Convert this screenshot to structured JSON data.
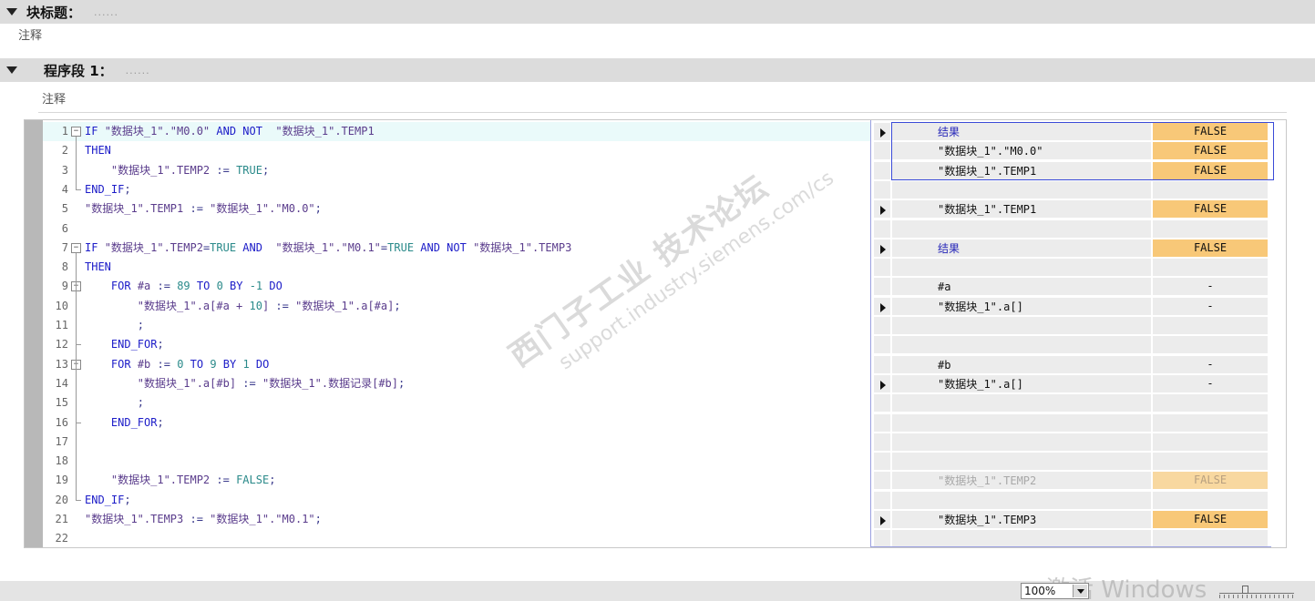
{
  "block": {
    "title": "块标题：",
    "placeholder": "......",
    "comment": "注释"
  },
  "network": {
    "title": "程序段 1：",
    "placeholder": "......",
    "comment": "注释"
  },
  "code": [
    {
      "n": "1",
      "tokens": [
        [
          "kw",
          "IF "
        ],
        [
          "str",
          "\"数据块_1\".\"M0.0\" "
        ],
        [
          "kw",
          "AND NOT  "
        ],
        [
          "str",
          "\"数据块_1\".TEMP1"
        ]
      ]
    },
    {
      "n": "2",
      "tokens": [
        [
          "kw",
          "THEN"
        ]
      ]
    },
    {
      "n": "3",
      "tokens": [
        [
          "t",
          "    "
        ],
        [
          "str",
          "\"数据块_1\".TEMP2 "
        ],
        [
          "t",
          ":= "
        ],
        [
          "num",
          "TRUE"
        ],
        [
          "t",
          ";"
        ]
      ]
    },
    {
      "n": "4",
      "tokens": [
        [
          "kw",
          "END_IF"
        ],
        [
          "t",
          ";"
        ]
      ]
    },
    {
      "n": "5",
      "tokens": [
        [
          "str",
          "\"数据块_1\".TEMP1 "
        ],
        [
          "t",
          ":= "
        ],
        [
          "str",
          "\"数据块_1\".\"M0.0\""
        ],
        [
          "t",
          ";"
        ]
      ]
    },
    {
      "n": "6",
      "tokens": []
    },
    {
      "n": "7",
      "tokens": [
        [
          "kw",
          "IF "
        ],
        [
          "str",
          "\"数据块_1\".TEMP2"
        ],
        [
          "t",
          "="
        ],
        [
          "num",
          "TRUE "
        ],
        [
          "kw",
          "AND  "
        ],
        [
          "str",
          "\"数据块_1\".\"M0.1\""
        ],
        [
          "t",
          "="
        ],
        [
          "num",
          "TRUE "
        ],
        [
          "kw",
          "AND NOT "
        ],
        [
          "str",
          "\"数据块_1\".TEMP3"
        ]
      ]
    },
    {
      "n": "8",
      "tokens": [
        [
          "kw",
          "THEN"
        ]
      ]
    },
    {
      "n": "9",
      "tokens": [
        [
          "t",
          "    "
        ],
        [
          "kw",
          "FOR "
        ],
        [
          "str",
          "#a "
        ],
        [
          "t",
          ":= "
        ],
        [
          "num",
          "89 "
        ],
        [
          "kw",
          "TO "
        ],
        [
          "num",
          "0 "
        ],
        [
          "kw",
          "BY "
        ],
        [
          "num",
          "-1 "
        ],
        [
          "kw",
          "DO"
        ]
      ]
    },
    {
      "n": "10",
      "tokens": [
        [
          "t",
          "        "
        ],
        [
          "str",
          "\"数据块_1\".a[#a + "
        ],
        [
          "num",
          "10"
        ],
        [
          "str",
          "] "
        ],
        [
          "t",
          ":= "
        ],
        [
          "str",
          "\"数据块_1\".a[#a]"
        ],
        [
          "t",
          ";"
        ]
      ]
    },
    {
      "n": "11",
      "tokens": [
        [
          "t",
          "        ;"
        ]
      ]
    },
    {
      "n": "12",
      "tokens": [
        [
          "t",
          "    "
        ],
        [
          "kw",
          "END_FOR"
        ],
        [
          "t",
          ";"
        ]
      ]
    },
    {
      "n": "13",
      "tokens": [
        [
          "t",
          "    "
        ],
        [
          "kw",
          "FOR "
        ],
        [
          "str",
          "#b "
        ],
        [
          "t",
          ":= "
        ],
        [
          "num",
          "0 "
        ],
        [
          "kw",
          "TO "
        ],
        [
          "num",
          "9 "
        ],
        [
          "kw",
          "BY "
        ],
        [
          "num",
          "1 "
        ],
        [
          "kw",
          "DO"
        ]
      ]
    },
    {
      "n": "14",
      "tokens": [
        [
          "t",
          "        "
        ],
        [
          "str",
          "\"数据块_1\".a[#b] "
        ],
        [
          "t",
          ":= "
        ],
        [
          "str",
          "\"数据块_1\".数据记录[#b]"
        ],
        [
          "t",
          ";"
        ]
      ]
    },
    {
      "n": "15",
      "tokens": [
        [
          "t",
          "        ;"
        ]
      ]
    },
    {
      "n": "16",
      "tokens": [
        [
          "t",
          "    "
        ],
        [
          "kw",
          "END_FOR"
        ],
        [
          "t",
          ";"
        ]
      ]
    },
    {
      "n": "17",
      "tokens": []
    },
    {
      "n": "18",
      "tokens": []
    },
    {
      "n": "19",
      "tokens": [
        [
          "t",
          "    "
        ],
        [
          "str",
          "\"数据块_1\".TEMP2 "
        ],
        [
          "t",
          ":= "
        ],
        [
          "num",
          "FALSE"
        ],
        [
          "t",
          ";"
        ]
      ]
    },
    {
      "n": "20",
      "tokens": [
        [
          "kw",
          "END_IF"
        ],
        [
          "t",
          ";"
        ]
      ]
    },
    {
      "n": "21",
      "tokens": [
        [
          "str",
          "\"数据块_1\".TEMP3 "
        ],
        [
          "t",
          ":= "
        ],
        [
          "str",
          "\"数据块_1\".\"M0.1\""
        ],
        [
          "t",
          ";"
        ]
      ]
    },
    {
      "n": "22",
      "tokens": []
    }
  ],
  "watch": [
    {
      "arrow": true,
      "name": "结果",
      "style": "blue",
      "value": "FALSE",
      "vstyle": "false"
    },
    {
      "arrow": false,
      "name": "\"数据块_1\".\"M0.0\"",
      "style": "",
      "value": "FALSE",
      "vstyle": "false"
    },
    {
      "arrow": false,
      "name": "\"数据块_1\".TEMP1",
      "style": "",
      "value": "FALSE",
      "vstyle": "false"
    },
    {
      "arrow": false,
      "name": "",
      "style": "",
      "value": "",
      "vstyle": ""
    },
    {
      "arrow": true,
      "name": "\"数据块_1\".TEMP1",
      "style": "",
      "value": "FALSE",
      "vstyle": "false"
    },
    {
      "arrow": false,
      "name": "",
      "style": "",
      "value": "",
      "vstyle": ""
    },
    {
      "arrow": true,
      "name": "结果",
      "style": "blue",
      "value": "FALSE",
      "vstyle": "false"
    },
    {
      "arrow": false,
      "name": "",
      "style": "",
      "value": "",
      "vstyle": ""
    },
    {
      "arrow": false,
      "name": "#a",
      "style": "",
      "value": "-",
      "vstyle": ""
    },
    {
      "arrow": true,
      "name": "\"数据块_1\".a[]",
      "style": "",
      "value": "-",
      "vstyle": ""
    },
    {
      "arrow": false,
      "name": "",
      "style": "",
      "value": "",
      "vstyle": ""
    },
    {
      "arrow": false,
      "name": "",
      "style": "",
      "value": "",
      "vstyle": ""
    },
    {
      "arrow": false,
      "name": "#b",
      "style": "",
      "value": "-",
      "vstyle": ""
    },
    {
      "arrow": true,
      "name": "\"数据块_1\".a[]",
      "style": "",
      "value": "-",
      "vstyle": ""
    },
    {
      "arrow": false,
      "name": "",
      "style": "",
      "value": "",
      "vstyle": ""
    },
    {
      "arrow": false,
      "name": "",
      "style": "",
      "value": "",
      "vstyle": ""
    },
    {
      "arrow": false,
      "name": "",
      "style": "",
      "value": "",
      "vstyle": ""
    },
    {
      "arrow": false,
      "name": "",
      "style": "",
      "value": "",
      "vstyle": ""
    },
    {
      "arrow": false,
      "name": "\"数据块_1\".TEMP2",
      "style": "dim",
      "value": "FALSE",
      "vstyle": "false dim"
    },
    {
      "arrow": false,
      "name": "",
      "style": "",
      "value": "",
      "vstyle": ""
    },
    {
      "arrow": true,
      "name": "\"数据块_1\".TEMP3",
      "style": "",
      "value": "FALSE",
      "vstyle": "false"
    },
    {
      "arrow": false,
      "name": "",
      "style": "",
      "value": "",
      "vstyle": ""
    }
  ],
  "watermark": {
    "main": "西门子工业 技术论坛",
    "url": "support.industry.siemens.com/cs"
  },
  "status": {
    "zoom": "100%",
    "activate": "激活 Windows"
  },
  "colors": {
    "false_value_bg": "#f8c878",
    "keyword": "#1c1cc8",
    "selection_border": "#3a4ad8",
    "header_bg": "#dcdcdc"
  }
}
